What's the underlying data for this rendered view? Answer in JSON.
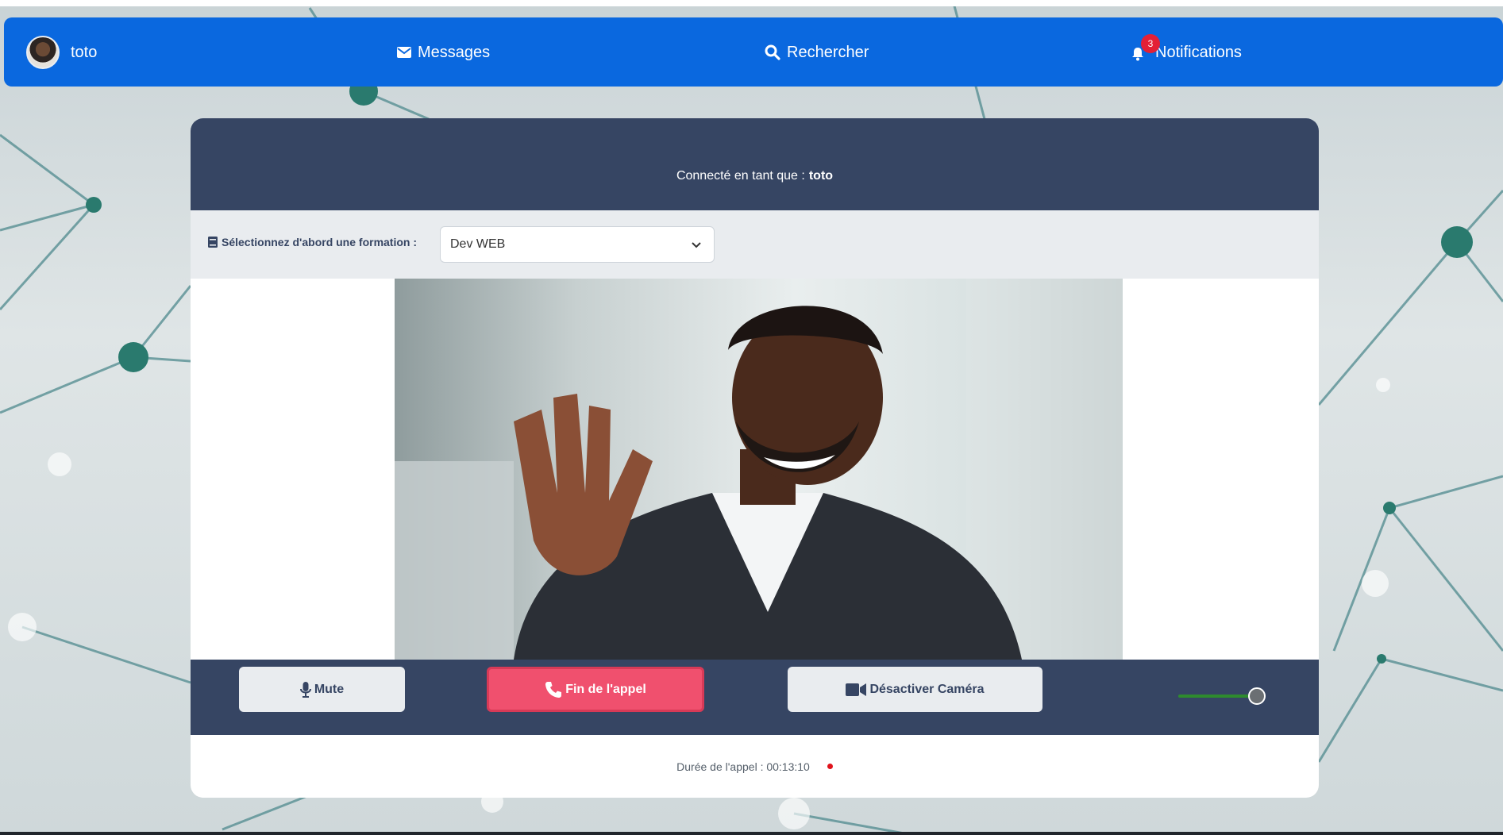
{
  "navbar": {
    "user_name": "toto",
    "messages_label": "Messages",
    "search_label": "Rechercher",
    "notifications_label": "Notifications",
    "notifications_count": "3"
  },
  "call": {
    "connected_prefix": "Connecté en tant que :",
    "connected_user": "toto",
    "formation_label": "Sélectionnez d'abord une formation :",
    "formation_value": "Dev WEB",
    "mute_label": "Mute",
    "end_call_label": "Fin de l'appel",
    "camera_label": "Désactiver Caméra",
    "volume_level": 0.9,
    "duration_text": "Durée de l'appel : 00:13:10"
  },
  "colors": {
    "navbar": "#0a68df",
    "card_header": "#364563",
    "end_call": "#f0506e",
    "badge": "#e32036",
    "record_dot": "#e0131c"
  },
  "icons": {
    "messages": "envelope-icon",
    "search": "search-icon",
    "notifications": "bell-icon",
    "formation": "book-icon",
    "mute": "microphone-icon",
    "end_call": "phone-icon",
    "camera": "video-camera-icon"
  }
}
